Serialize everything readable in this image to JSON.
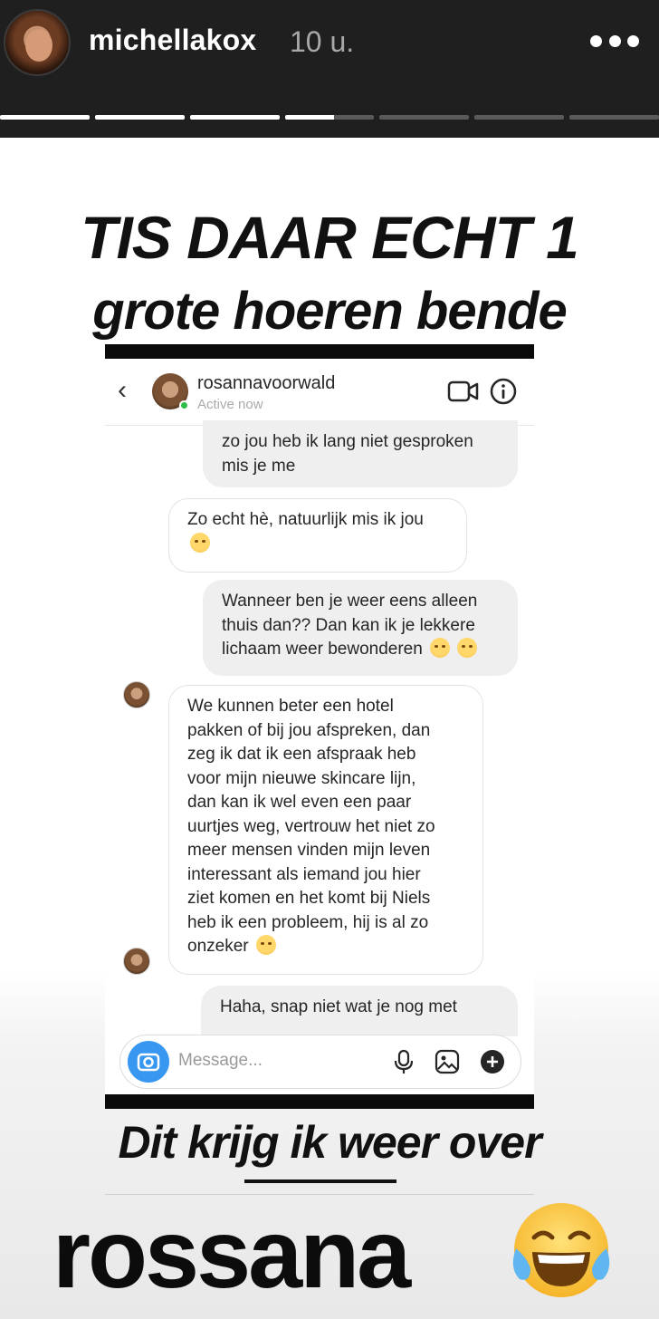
{
  "story": {
    "username": "michellakox",
    "time_ago": "10 u.",
    "progress_segments": [
      1,
      1,
      1,
      0.55,
      0,
      0,
      0
    ]
  },
  "headline": {
    "line1": "TIS DAAR ECHT 1",
    "line2": "grote hoeren bende"
  },
  "dm": {
    "contact_name": "rosannavoorwald",
    "contact_status": "Active now",
    "messages": [
      {
        "direction": "out",
        "text": "zo jou heb ik lang niet gesproken\nmis je me"
      },
      {
        "direction": "in",
        "text": "Zo echt hè, natuurlijk mis ik jou",
        "emoji": "hugging-face"
      },
      {
        "direction": "out",
        "text": "Wanneer ben je weer eens alleen\nthuis dan?? Dan kan ik je lekkere\nlichaam weer bewonderen",
        "emoji": "smirk, relieved"
      },
      {
        "direction": "in",
        "text": "We kunnen beter een hotel\npakken of bij jou afspreken, dan\nzeg ik dat ik een afspraak heb\nvoor mijn nieuwe skincare lijn,\ndan kan ik wel even een paar\nuurtjes weg, vertrouw het niet zo\nmeer mensen vinden mijn leven\ninteressant als iemand jou hier\nziet komen en het komt bij Niels\nheb ik een probleem, hij is al zo\nonzeker",
        "emoji": "tears-of-joy"
      },
      {
        "direction": "out",
        "text": "Haha, snap niet wat je nog met"
      }
    ],
    "composer_placeholder": "Message..."
  },
  "captions": {
    "line1": "Dit krijg ik weer over",
    "line2": "rossana",
    "emoji": "face-with-tears-of-joy"
  },
  "colors": {
    "header_bg": "#1f1f1f",
    "instagram_blue": "#3897f0",
    "online_green": "#2bbd46"
  }
}
